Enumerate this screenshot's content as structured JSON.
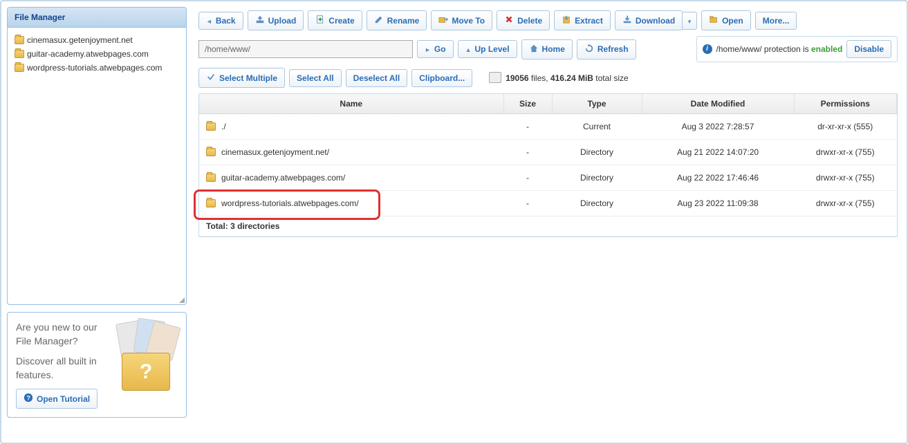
{
  "sidebar": {
    "title": "File Manager",
    "tree": [
      "cinemasux.getenjoyment.net",
      "guitar-academy.atwebpages.com",
      "wordpress-tutorials.atwebpages.com"
    ],
    "tutorial": {
      "line1": "Are you new to our File Manager?",
      "line2": "Discover all built in features.",
      "button": "Open Tutorial"
    }
  },
  "toolbar": {
    "back": "Back",
    "upload": "Upload",
    "create": "Create",
    "rename": "Rename",
    "moveto": "Move To",
    "delete": "Delete",
    "extract": "Extract",
    "download": "Download",
    "open": "Open",
    "more": "More..."
  },
  "path": {
    "value": "/home/www/",
    "go": "Go",
    "uplevel": "Up Level",
    "home": "Home",
    "refresh": "Refresh"
  },
  "protection": {
    "path": "/home/www/",
    "label1": " protection is ",
    "status": "enabled",
    "disable": "Disable"
  },
  "selectbar": {
    "selectmultiple": "Select Multiple",
    "selectall": "Select All",
    "deselectall": "Deselect All",
    "clipboard": "Clipboard..."
  },
  "stats": {
    "count": "19056",
    "label1": " files, ",
    "size": "416.24 MiB",
    "label2": " total size"
  },
  "table": {
    "headers": {
      "name": "Name",
      "size": "Size",
      "type": "Type",
      "date": "Date Modified",
      "perm": "Permissions"
    },
    "rows": [
      {
        "name": "./",
        "size": "-",
        "type": "Current",
        "date": "Aug 3 2022 7:28:57",
        "perm": "dr-xr-xr-x (555)",
        "hi": false
      },
      {
        "name": "cinemasux.getenjoyment.net/",
        "size": "-",
        "type": "Directory",
        "date": "Aug 21 2022 14:07:20",
        "perm": "drwxr-xr-x (755)",
        "hi": false
      },
      {
        "name": "guitar-academy.atwebpages.com/",
        "size": "-",
        "type": "Directory",
        "date": "Aug 22 2022 17:46:46",
        "perm": "drwxr-xr-x (755)",
        "hi": false
      },
      {
        "name": "wordpress-tutorials.atwebpages.com/",
        "size": "-",
        "type": "Directory",
        "date": "Aug 23 2022 11:09:38",
        "perm": "drwxr-xr-x (755)",
        "hi": true
      }
    ],
    "total": "Total: 3 directories"
  }
}
